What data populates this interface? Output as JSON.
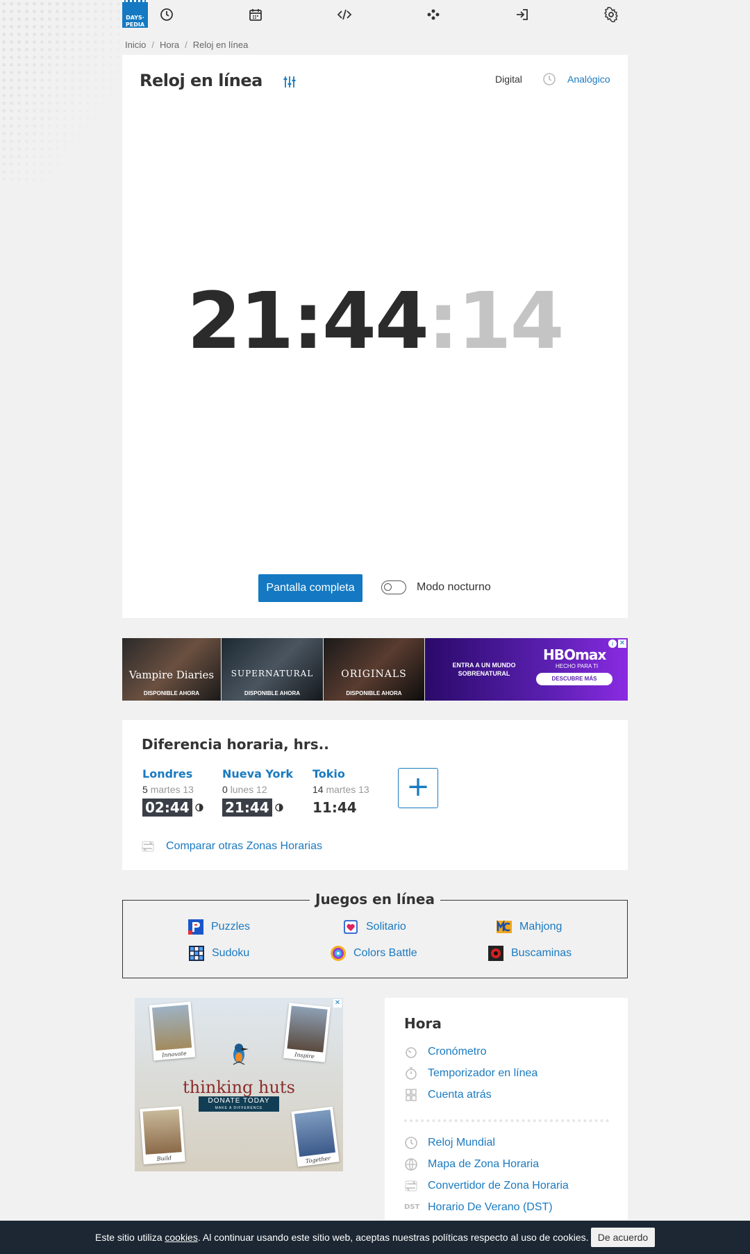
{
  "nav": {
    "logo_line1": "DAYS·",
    "logo_line2": "PEDIA",
    "icons": [
      "clock-icon",
      "calendar-icon",
      "code-icon",
      "network-icon",
      "login-icon",
      "gear-icon"
    ]
  },
  "breadcrumb": [
    "Inicio",
    "Hora",
    "Reloj en línea"
  ],
  "clock": {
    "title": "Reloj en línea",
    "mode_digital": "Digital",
    "mode_analog": "Analógico",
    "time_hm": "21:44",
    "time_sep": ":",
    "time_sec": "14",
    "fullscreen_label": "Pantalla completa",
    "night_mode_label": "Modo nocturno"
  },
  "ad_banner": {
    "shows": [
      {
        "name": "Vampire Diaries",
        "cta": "DISPONIBLE AHORA"
      },
      {
        "name": "SUPERNATURAL",
        "cta": "DISPONIBLE AHORA"
      },
      {
        "name": "ORIGINALS",
        "cta": "DISPONIBLE AHORA"
      }
    ],
    "hbo_left": "ENTRA A UN MUNDO SOBRENATURAL",
    "hbo_logo": "HBOmax",
    "hbo_sub": "HECHO PARA TI",
    "hbo_button": "DESCUBRE MÁS"
  },
  "time_diff": {
    "title": "Diferencia horaria, hrs..",
    "cities": [
      {
        "name": "Londres",
        "diff": "5",
        "day": "martes 13",
        "time": "02:44"
      },
      {
        "name": "Nueva York",
        "diff": "0",
        "day": "lunes 12",
        "time": "21:44"
      },
      {
        "name": "Tokio",
        "diff": "14",
        "day": "martes 13",
        "time": "11:44"
      }
    ],
    "add_label": "+",
    "compare_label": "Comparar otras Zonas Horarias"
  },
  "games": {
    "title": "Juegos en línea",
    "items": [
      "Puzzles",
      "Solitario",
      "Mahjong",
      "Sudoku",
      "Colors Battle",
      "Buscaminas"
    ]
  },
  "ad_square": {
    "brand": "thinking huts",
    "donate": "DONATE TODAY",
    "donate_sub": "MAKE A DIFFERENCE",
    "captions": [
      "Innovate",
      "Inspire",
      "Build",
      "Together"
    ]
  },
  "hora": {
    "title": "Hora",
    "items_top": [
      "Cronómetro",
      "Temporizador en línea",
      "Cuenta atrás"
    ],
    "items_bottom": [
      "Reloj Mundial",
      "Mapa de Zona Horaria",
      "Convertidor de Zona Horaria",
      "Horario De Verano (DST)"
    ],
    "dst_label": "DST"
  },
  "cookie": {
    "pre": "Este sitio utiliza ",
    "link": "cookies",
    "post": ". Al continuar usando este sitio web, aceptas nuestras políticas respecto al uso de cookies.",
    "button": "De acuerdo"
  },
  "colors": {
    "accent": "#1479c2",
    "link": "#1a7ac0",
    "cookie_bg": "#1c2733"
  }
}
